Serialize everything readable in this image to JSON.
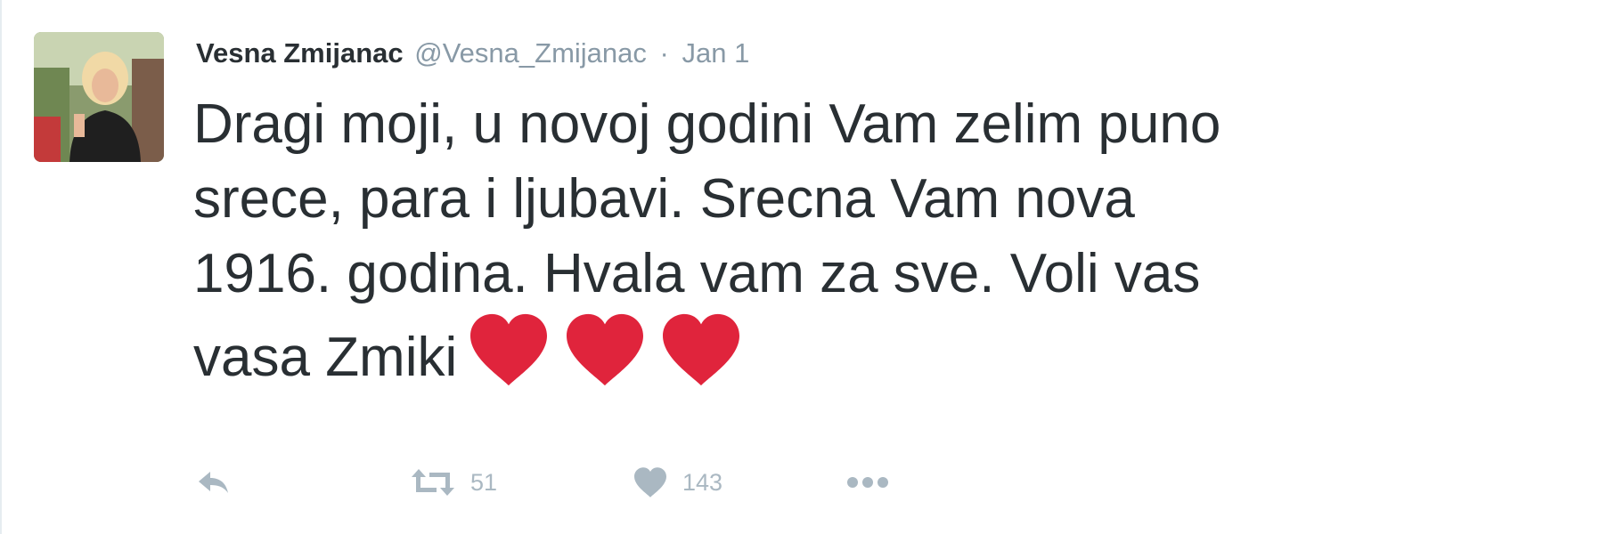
{
  "tweet": {
    "author_name": "Vesna Zmijanac",
    "author_handle": "@Vesna_Zmijanac",
    "separator": "·",
    "timestamp": "Jan 1",
    "text": "Dragi moji, u novoj godini Vam zelim puno\nsrece, para i ljubavi. Srecna Vam nova\n1916. godina. Hvala vam za sve. Voli vas\nvasa Zmiki",
    "emoji": [
      "heart-emoji",
      "heart-emoji",
      "heart-emoji"
    ],
    "heart_color": "#e0243c",
    "actions": {
      "reply_icon": "reply-icon",
      "retweet_icon": "retweet-icon",
      "retweet_count": "51",
      "like_icon": "heart-icon",
      "like_count": "143",
      "more_icon": "more-icon"
    },
    "icon_color": "#aab8c2"
  }
}
